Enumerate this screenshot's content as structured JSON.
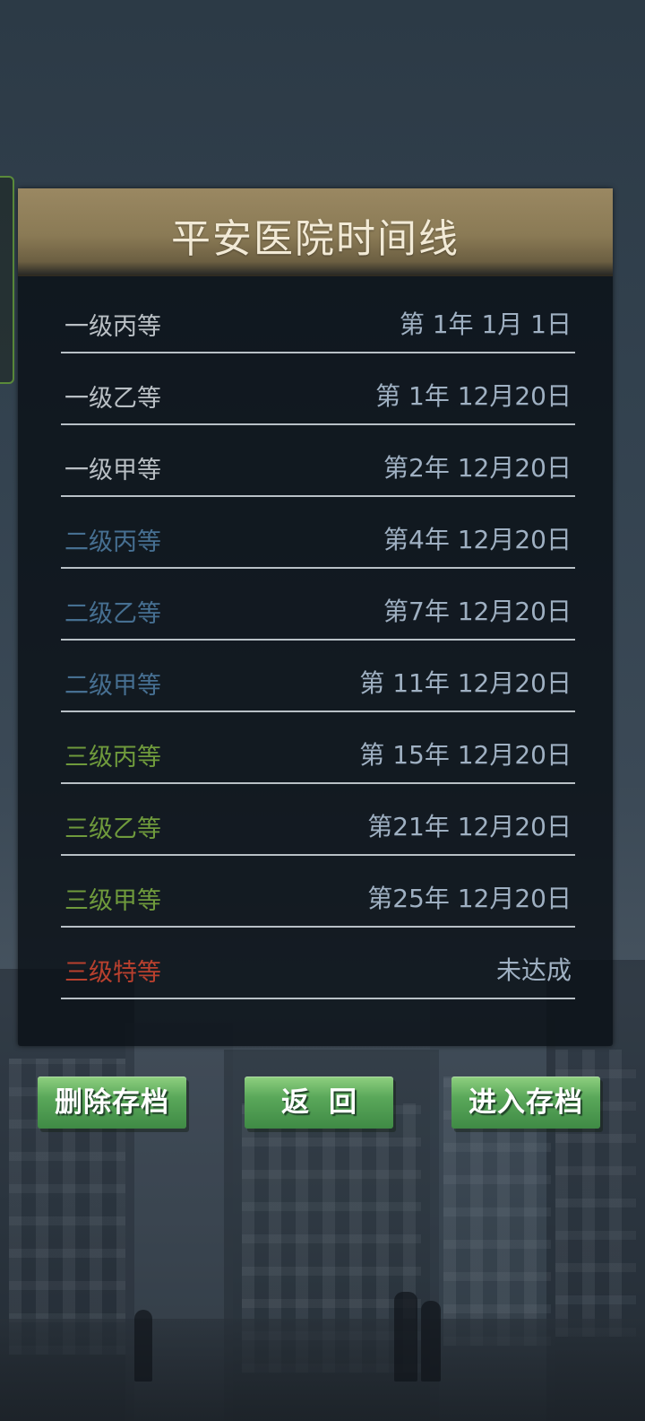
{
  "title": "平安医院时间线",
  "timeline": [
    {
      "level": "一级丙等",
      "date": "第 1年 1月 1日",
      "color": "#b9bfc4"
    },
    {
      "level": "一级乙等",
      "date": "第 1年 12月20日",
      "color": "#b9bfc4"
    },
    {
      "level": "一级甲等",
      "date": "第2年 12月20日",
      "color": "#b9bfc4"
    },
    {
      "level": "二级丙等",
      "date": "第4年 12月20日",
      "color": "#466f91"
    },
    {
      "level": "二级乙等",
      "date": "第7年 12月20日",
      "color": "#466f91"
    },
    {
      "level": "二级甲等",
      "date": "第 11年 12月20日",
      "color": "#466f91"
    },
    {
      "level": "三级丙等",
      "date": "第 15年 12月20日",
      "color": "#6f9a3c"
    },
    {
      "level": "三级乙等",
      "date": "第21年 12月20日",
      "color": "#6f9a3c"
    },
    {
      "level": "三级甲等",
      "date": "第25年 12月20日",
      "color": "#6f9a3c"
    },
    {
      "level": "三级特等",
      "date": "未达成",
      "color": "#b8402e"
    }
  ],
  "buttons": {
    "delete": "删除存档",
    "back": "返回",
    "enter": "进入存档"
  }
}
